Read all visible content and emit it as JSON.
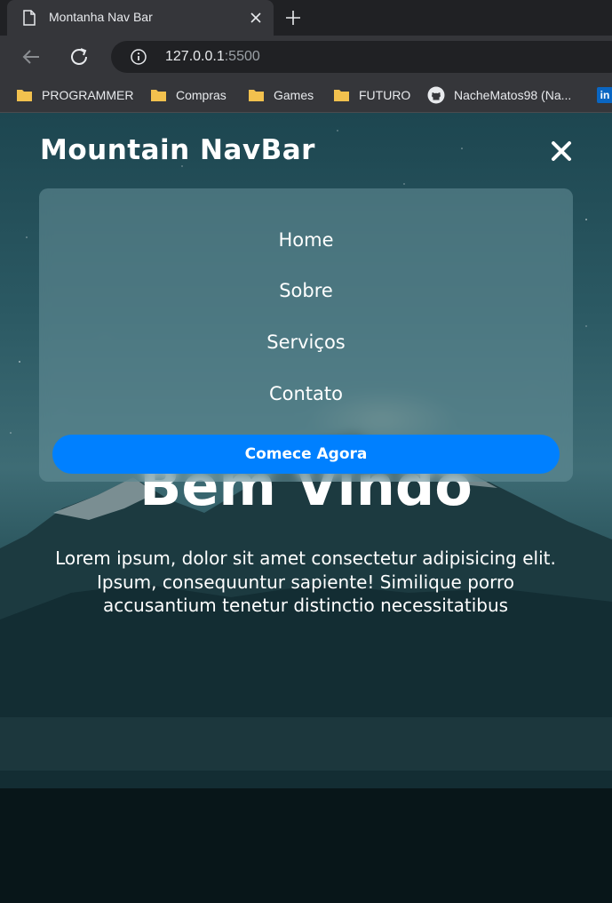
{
  "browser": {
    "tab": {
      "title": "Montanha Nav Bar",
      "favicon": "document-icon"
    },
    "url": {
      "host": "127.0.0.1",
      "port": ":5500"
    },
    "bookmarks": [
      {
        "label": "PROGRAMMER",
        "icon": "folder-icon"
      },
      {
        "label": "Compras",
        "icon": "folder-icon"
      },
      {
        "label": "Games",
        "icon": "folder-icon"
      },
      {
        "label": "FUTURO",
        "icon": "folder-icon"
      },
      {
        "label": "NacheMatos98 (Na...",
        "icon": "github-icon"
      },
      {
        "label": "in",
        "icon": "linkedin-icon"
      }
    ]
  },
  "navbar": {
    "brand": "Mountain NavBar",
    "menu": [
      "Home",
      "Sobre",
      "Serviços",
      "Contato"
    ],
    "cta": "Comece Agora"
  },
  "hero": {
    "title": "Bem Vindo",
    "text_line1": "Lorem ipsum, dolor sit amet consectetur adipisicing elit.",
    "text_line2": "Ipsum, consequuntur sapiente! Similique porro accusantium tenetur distinctio necessitatibus"
  },
  "colors": {
    "accent": "#0080ff",
    "chrome_dark": "#202124",
    "chrome_tab": "#35363a",
    "folder": "#f2c14e"
  }
}
